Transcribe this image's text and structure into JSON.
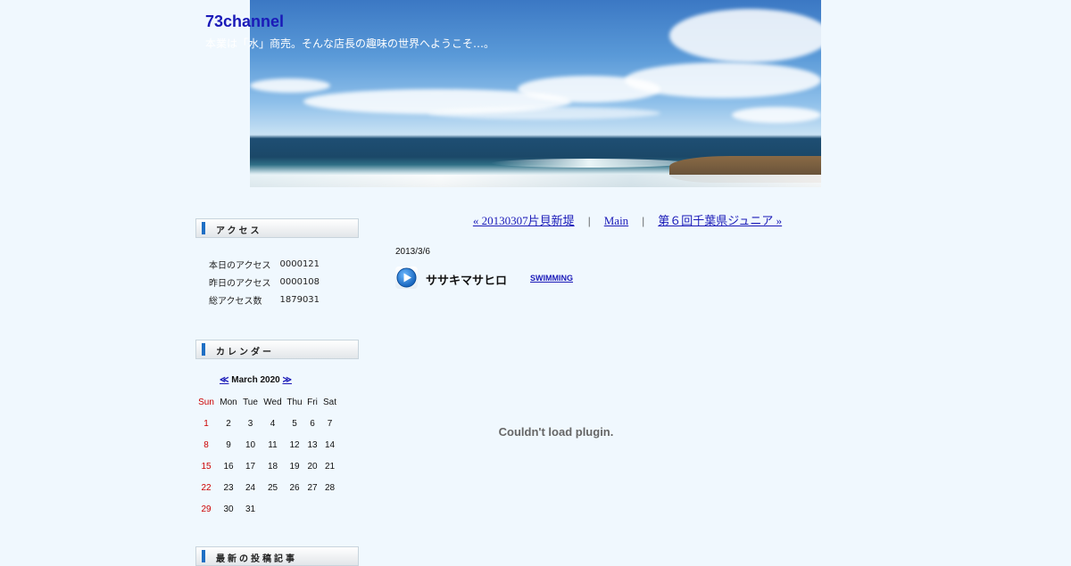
{
  "header": {
    "site_title": "73channel",
    "site_description": "本業は「水」商売。そんな店長の趣味の世界へようこそ…。"
  },
  "sidebar": {
    "access": {
      "heading": "アクセス",
      "rows": [
        {
          "label": "本日のアクセス",
          "value": "0000121"
        },
        {
          "label": "昨日のアクセス",
          "value": "0000108"
        },
        {
          "label": "総アクセス数",
          "value": "1879031"
        }
      ]
    },
    "calendar": {
      "heading": "カレンダー",
      "prev": "≪",
      "month": "March 2020",
      "next": "≫",
      "weekdays": [
        "Sun",
        "Mon",
        "Tue",
        "Wed",
        "Thu",
        "Fri",
        "Sat"
      ],
      "weeks": [
        [
          "1",
          "2",
          "3",
          "4",
          "5",
          "6",
          "7"
        ],
        [
          "8",
          "9",
          "10",
          "11",
          "12",
          "13",
          "14"
        ],
        [
          "15",
          "16",
          "17",
          "18",
          "19",
          "20",
          "21"
        ],
        [
          "22",
          "23",
          "24",
          "25",
          "26",
          "27",
          "28"
        ],
        [
          "29",
          "30",
          "31",
          "",
          "",
          "",
          ""
        ]
      ]
    },
    "recent_posts": {
      "heading": "最新の投稿記事"
    }
  },
  "nav": {
    "prev": "« 20130307片貝新堤",
    "separator": "|",
    "main": "Main",
    "next": "第６回千葉県ジュニア »"
  },
  "post": {
    "date": "2013/3/6",
    "title": "ササキマサヒロ",
    "category": "SWIMMING",
    "plugin_message": "Couldn't load plugin."
  },
  "colors": {
    "background": "#f0f8fe",
    "link": "#1a1ab8",
    "sunday": "#cc0000",
    "heading_bar": "#1f6fc4"
  }
}
